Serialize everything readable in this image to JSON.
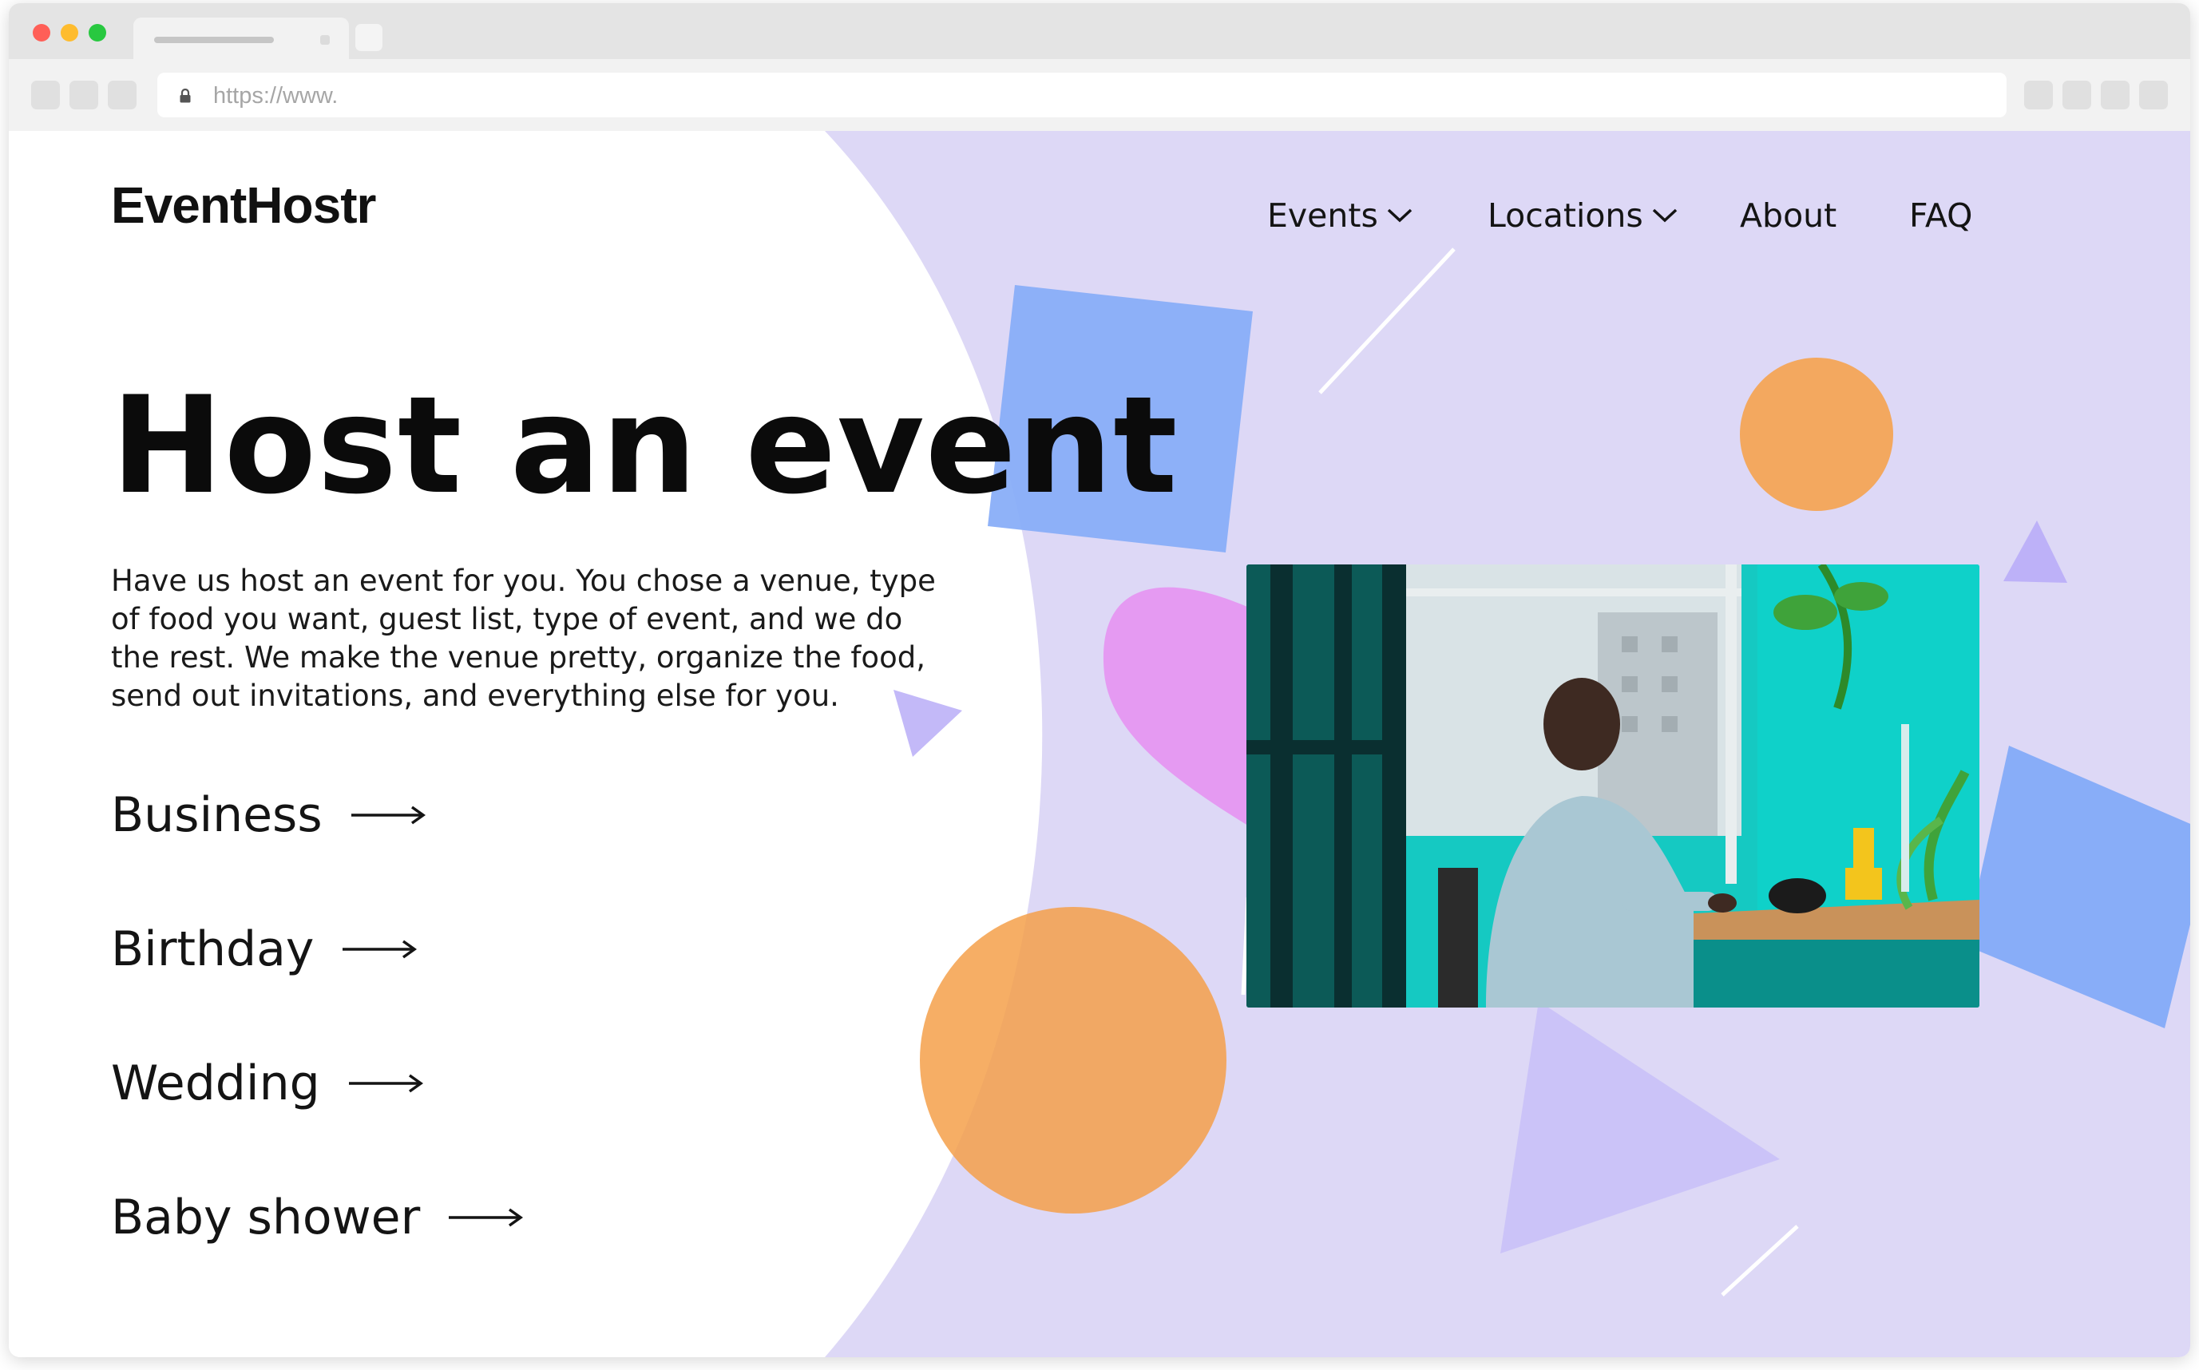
{
  "browser": {
    "url": "https://www.",
    "lock_icon": "lock-icon"
  },
  "site": {
    "logo": "EventHostr",
    "nav": [
      {
        "label": "Events",
        "has_dropdown": true
      },
      {
        "label": "Locations",
        "has_dropdown": true
      },
      {
        "label": "About",
        "has_dropdown": false
      },
      {
        "label": "FAQ",
        "has_dropdown": false
      }
    ]
  },
  "hero": {
    "title": "Host an event",
    "description": "Have us host an event for you. You chose a venue, type of food you want, guest list, type of event, and we do the rest. We make the venue pretty, organize the food, send out invitations, and everything else for you.",
    "categories": [
      {
        "label": "Business",
        "icon": "arrow-right-icon"
      },
      {
        "label": "Birthday",
        "icon": "arrow-right-icon"
      },
      {
        "label": "Wedding",
        "icon": "arrow-right-icon"
      },
      {
        "label": "Baby shower",
        "icon": "arrow-right-icon"
      }
    ]
  },
  "colors": {
    "lavender_bg": "#ddd8f6",
    "blue_square": "#88adf8",
    "orange": "#f3a85f",
    "pink": "#e59af2",
    "light_purple": "#c3b9f8",
    "text": "#111111"
  }
}
